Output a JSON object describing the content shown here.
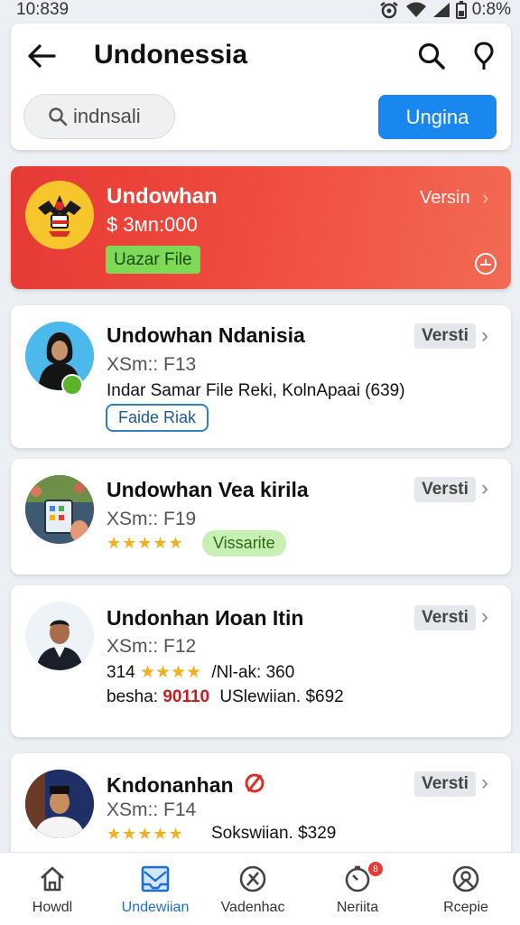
{
  "status_bar": {
    "time": "10:839",
    "battery": "0:8%"
  },
  "header": {
    "title": "Undonessia",
    "search_placeholder": "indnsali",
    "primary_button": "Ungina"
  },
  "featured": {
    "title": "Undowhan",
    "price": "$ 3мn:000",
    "chip": "Uazar File",
    "version": "Versin"
  },
  "items": [
    {
      "title": "Undowhan Ndanisia",
      "subtitle": "XSm:: F13",
      "line": "Indar Samar File Reki, KolnApaai (639)",
      "chip": "Faide Riak",
      "version": "Versti"
    },
    {
      "title": "Undowhan Vea kirila",
      "subtitle": "XSm:: F19",
      "stars": "★★★★★",
      "chip": "Vissarite",
      "version": "Versti"
    },
    {
      "title": "Undonhan Иoan Itin",
      "subtitle": "XSm:: F12",
      "rating_prefix": "314",
      "stars": "★★★★",
      "rating_suffix": "/Nl-ak: 360",
      "line2_prefix": "besha:",
      "line2_highlight": "90110",
      "line2_suffix": "USlewiian. $692",
      "version": "Versti"
    },
    {
      "title": "Kndonanhan",
      "subtitle": "XSm:: F14",
      "stars": "★★★★★",
      "line": "Sokswiian. $329",
      "version": "Versti"
    }
  ],
  "bottom_nav": [
    {
      "label": "Howdl",
      "icon": "home-icon",
      "active": false
    },
    {
      "label": "Undewiian",
      "icon": "inbox-icon",
      "active": true
    },
    {
      "label": "Vadenhac",
      "icon": "compass-icon",
      "active": false
    },
    {
      "label": "Nerіita",
      "icon": "timer-icon",
      "active": false,
      "badge": "8"
    },
    {
      "label": "Rcepie",
      "icon": "profile-icon",
      "active": false
    }
  ],
  "colors": {
    "accent": "#1a86f0",
    "featured_gradient_start": "#e63a35",
    "featured_gradient_end": "#f36a54",
    "chip_green": "#7ed957",
    "star": "#f2b01e"
  }
}
